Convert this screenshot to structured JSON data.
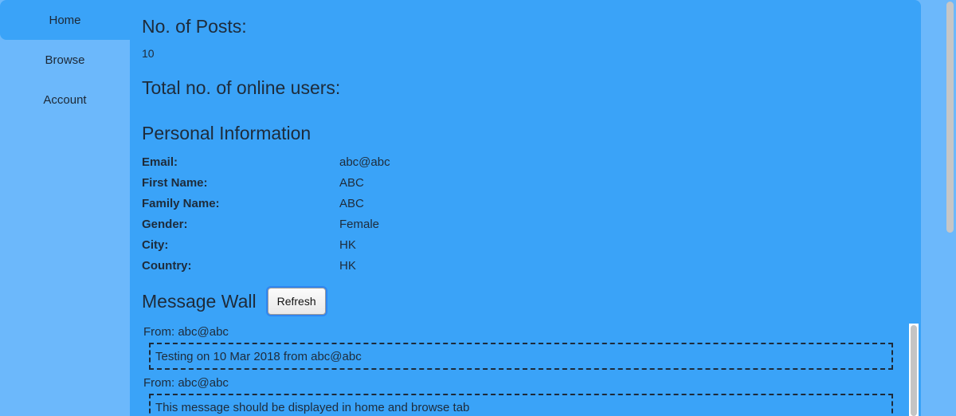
{
  "sidebar": {
    "items": [
      {
        "label": "Home"
      },
      {
        "label": "Browse"
      },
      {
        "label": "Account"
      }
    ]
  },
  "stats": {
    "posts_heading": "No. of Posts:",
    "posts_value": "10",
    "online_heading": "Total no. of online users:",
    "online_value": ""
  },
  "personal": {
    "heading": "Personal Information",
    "rows": [
      {
        "label": "Email:",
        "value": "abc@abc"
      },
      {
        "label": "First Name:",
        "value": "ABC"
      },
      {
        "label": "Family Name:",
        "value": "ABC"
      },
      {
        "label": "Gender:",
        "value": "Female"
      },
      {
        "label": "City:",
        "value": "HK"
      },
      {
        "label": "Country:",
        "value": "HK"
      }
    ]
  },
  "wall": {
    "heading": "Message Wall",
    "refresh_label": "Refresh",
    "messages": [
      {
        "from": "From: abc@abc",
        "text": "Testing on 10 Mar 2018 from abc@abc"
      },
      {
        "from": "From: abc@abc",
        "text": "This message should be displayed in home and browse tab"
      }
    ]
  },
  "colors": {
    "sidebar_bg": "#6cb8fb",
    "main_bg": "#3aa3f8",
    "text": "#1e2b3a"
  }
}
